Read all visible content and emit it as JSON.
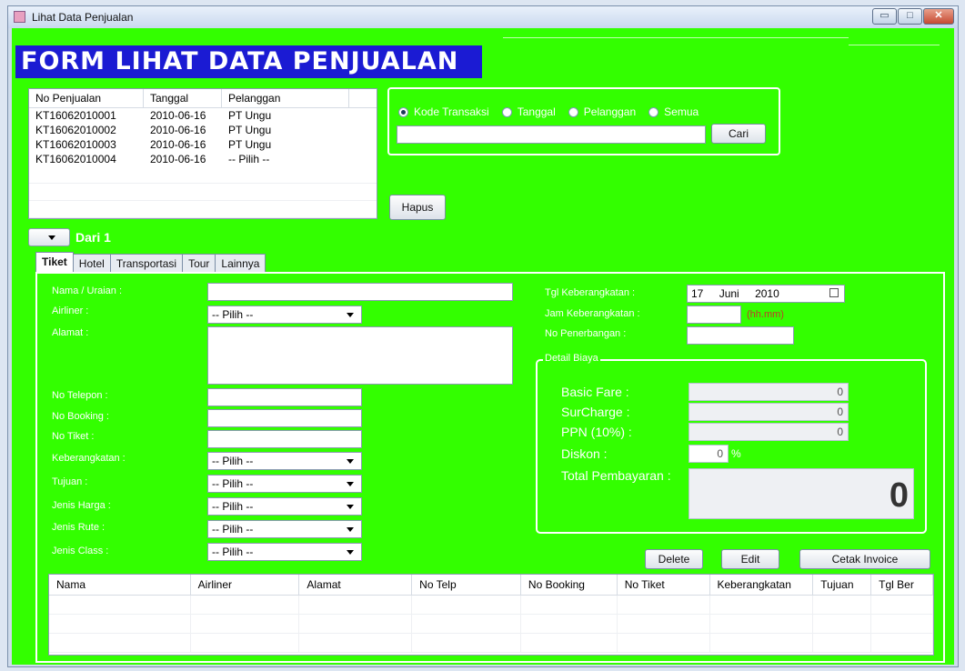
{
  "window": {
    "title": "Lihat Data Penjualan",
    "minimize_glyph": "▭",
    "maximize_glyph": "□",
    "close_glyph": "✕"
  },
  "form_title": "FORM LIHAT DATA PENJUALAN",
  "sales_list": {
    "columns": [
      "No Penjualan",
      "Tanggal",
      "Pelanggan"
    ],
    "rows": [
      [
        "KT16062010001",
        "2010-06-16",
        "PT Ungu"
      ],
      [
        "KT16062010002",
        "2010-06-16",
        "PT Ungu"
      ],
      [
        "KT16062010003",
        "2010-06-16",
        "PT Ungu"
      ],
      [
        "KT16062010004",
        "2010-06-16",
        "-- Pilih --"
      ]
    ]
  },
  "search": {
    "options": [
      "Kode Transaksi",
      "Tanggal",
      "Pelanggan",
      "Semua"
    ],
    "selected": "Kode Transaksi",
    "query": "",
    "button": "Cari"
  },
  "delete_sale_button": "Hapus",
  "pager": {
    "label": "Dari 1"
  },
  "tabs": [
    "Tiket",
    "Hotel",
    "Transportasi",
    "Tour",
    "Lainnya"
  ],
  "active_tab": "Tiket",
  "ticket_form": {
    "labels": {
      "nama": "Nama / Uraian :",
      "airliner": "Airliner :",
      "alamat": "Alamat :",
      "telepon": "No Telepon :",
      "booking": "No Booking :",
      "tiket": "No Tiket :",
      "keberangkatan": "Keberangkatan :",
      "tujuan": "Tujuan :",
      "jenis_harga": "Jenis Harga :",
      "jenis_rute": "Jenis Rute :",
      "jenis_class": "Jenis Class :",
      "tgl_keberangkatan": "Tgl Keberangkatan :",
      "jam_keberangkatan": "Jam Keberangkatan :",
      "no_penerbangan": "No Penerbangan :"
    },
    "select_placeholder": "-- Pilih --",
    "date": {
      "day": "17",
      "month": "Juni",
      "year": "2010"
    },
    "time_hint": "(hh.mm)",
    "colors": {
      "time_hint": "#c0392b",
      "background": "#33ff00"
    }
  },
  "cost_detail": {
    "legend": "Detail Biaya",
    "basic_fare_label": "Basic Fare :",
    "basic_fare": "0",
    "surcharge_label": "SurCharge :",
    "surcharge": "0",
    "ppn_label": "PPN (10%) :",
    "ppn": "0",
    "diskon_label": "Diskon :",
    "diskon": "0",
    "percent": "%",
    "total_label": "Total Pembayaran :",
    "total": "0"
  },
  "actions": {
    "delete": "Delete",
    "edit": "Edit",
    "print": "Cetak Invoice"
  },
  "detail_table": {
    "columns": [
      "Nama",
      "Airliner",
      "Alamat",
      "No Telp",
      "No Booking",
      "No Tiket",
      "Keberangkatan",
      "Tujuan",
      "Tgl Ber"
    ]
  }
}
